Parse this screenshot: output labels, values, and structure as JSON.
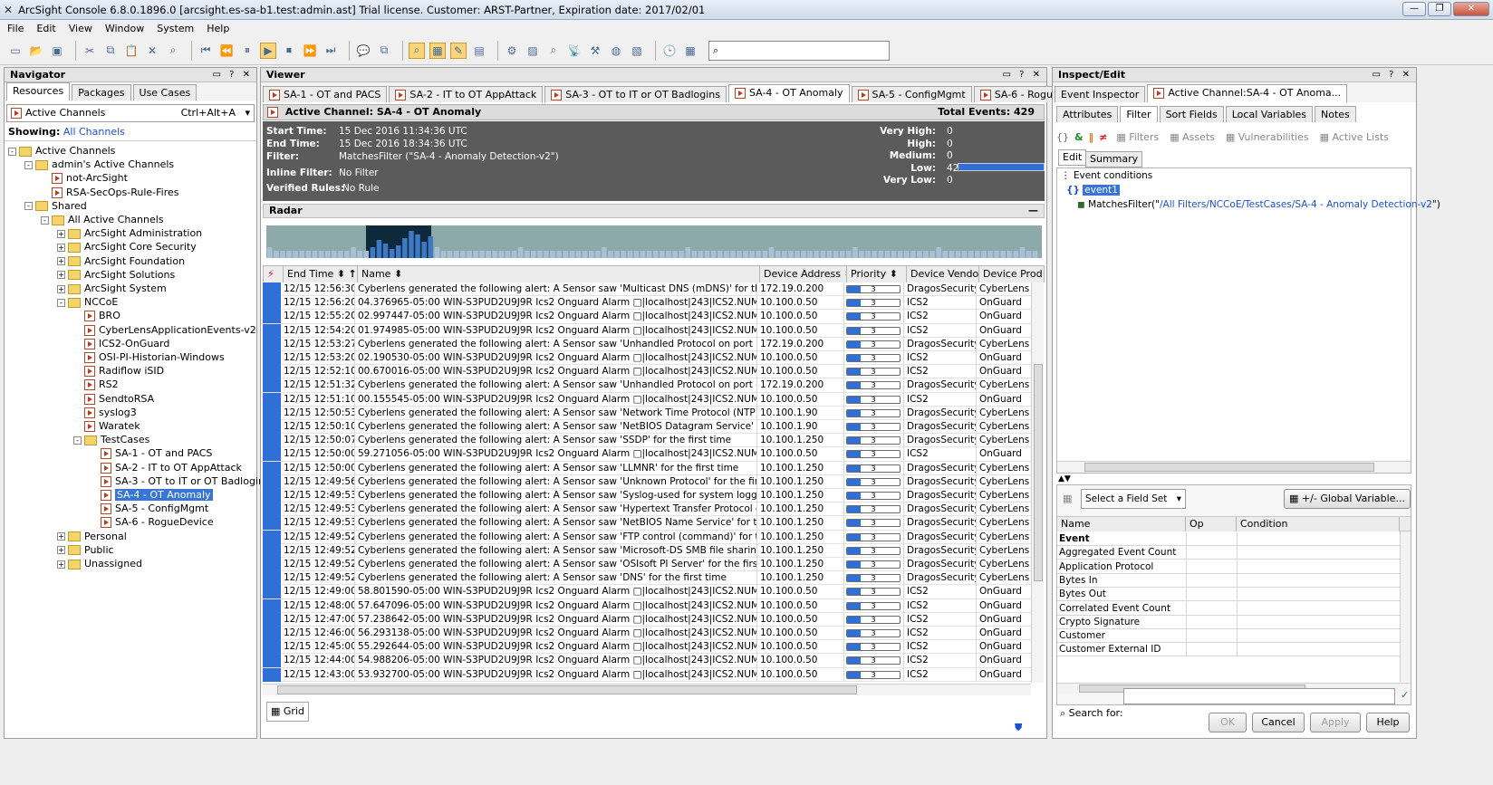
{
  "window": {
    "title": "ArcSight Console 6.8.0.1896.0 [arcsight.es-sa-b1.test:admin.ast] Trial license. Customer: ARST-Partner, Expiration date: 2017/02/01"
  },
  "menu": [
    "File",
    "Edit",
    "View",
    "Window",
    "System",
    "Help"
  ],
  "navigator": {
    "title": "Navigator",
    "tabs": [
      "Resources",
      "Packages",
      "Use Cases"
    ],
    "dropdown": "Active Channels",
    "shortcut": "Ctrl+Alt+A",
    "showing_label": "Showing:",
    "showing_value": "All Channels",
    "tree": [
      {
        "label": "Active Channels",
        "level": 0,
        "type": "folder",
        "pm": "-"
      },
      {
        "label": "admin's Active Channels",
        "level": 1,
        "type": "folder",
        "pm": "-"
      },
      {
        "label": "not-ArcSight",
        "level": 2,
        "type": "item"
      },
      {
        "label": "RSA-SecOps-Rule-Fires",
        "level": 2,
        "type": "item"
      },
      {
        "label": "Shared",
        "level": 1,
        "type": "folder",
        "pm": "-"
      },
      {
        "label": "All Active Channels",
        "level": 2,
        "type": "folder",
        "pm": "-"
      },
      {
        "label": "ArcSight Administration",
        "level": 3,
        "type": "folder",
        "pm": "+"
      },
      {
        "label": "ArcSight Core Security",
        "level": 3,
        "type": "folder",
        "pm": "+"
      },
      {
        "label": "ArcSight Foundation",
        "level": 3,
        "type": "folder",
        "pm": "+"
      },
      {
        "label": "ArcSight Solutions",
        "level": 3,
        "type": "folder",
        "pm": "+"
      },
      {
        "label": "ArcSight System",
        "level": 3,
        "type": "folder",
        "pm": "+"
      },
      {
        "label": "NCCoE",
        "level": 3,
        "type": "folder",
        "pm": "-"
      },
      {
        "label": "BRO",
        "level": 4,
        "type": "item"
      },
      {
        "label": "CyberLensApplicationEvents-v2",
        "level": 4,
        "type": "item"
      },
      {
        "label": "ICS2-OnGuard",
        "level": 4,
        "type": "item"
      },
      {
        "label": "OSI-PI-Historian-Windows",
        "level": 4,
        "type": "item"
      },
      {
        "label": "Radiflow iSID",
        "level": 4,
        "type": "item"
      },
      {
        "label": "RS2",
        "level": 4,
        "type": "item"
      },
      {
        "label": "SendtoRSA",
        "level": 4,
        "type": "item"
      },
      {
        "label": "syslog3",
        "level": 4,
        "type": "item"
      },
      {
        "label": "Waratek",
        "level": 4,
        "type": "item"
      },
      {
        "label": "TestCases",
        "level": 4,
        "type": "folder",
        "pm": "-"
      },
      {
        "label": "SA-1 - OT and PACS",
        "level": 5,
        "type": "item"
      },
      {
        "label": "SA-2 - IT to OT AppAttack",
        "level": 5,
        "type": "item"
      },
      {
        "label": "SA-3 - OT to IT or OT Badlogins",
        "level": 5,
        "type": "item"
      },
      {
        "label": "SA-4 - OT Anomaly",
        "level": 5,
        "type": "item",
        "selected": true
      },
      {
        "label": "SA-5 - ConfigMgmt",
        "level": 5,
        "type": "item"
      },
      {
        "label": "SA-6 - RogueDevice",
        "level": 5,
        "type": "item"
      },
      {
        "label": "Personal",
        "level": 3,
        "type": "folder",
        "pm": "+"
      },
      {
        "label": "Public",
        "level": 3,
        "type": "folder",
        "pm": "+"
      },
      {
        "label": "Unassigned",
        "level": 3,
        "type": "folder",
        "pm": "+"
      }
    ]
  },
  "viewer": {
    "title": "Viewer",
    "tabs": [
      "SA-1 - OT and PACS",
      "SA-2 - IT to OT AppAttack",
      "SA-3 - OT to IT or OT Badlogins",
      "SA-4 - OT Anomaly",
      "SA-5 - ConfigMgmt",
      "SA-6 - RogueDevice"
    ],
    "active_tab": 3,
    "channel_label": "Active Channel:",
    "channel_name": "SA-4 - OT Anomaly",
    "total_label": "Total Events:",
    "total_value": "429",
    "info": {
      "start_k": "Start Time:",
      "start_v": "15 Dec 2016 11:34:36 UTC",
      "end_k": "End Time:",
      "end_v": "15 Dec 2016 18:34:36 UTC",
      "filter_k": "Filter:",
      "filter_v": "MatchesFilter (\"SA-4 - Anomaly Detection-v2\")",
      "inline_k": "Inline Filter:",
      "inline_v": "No Filter",
      "verified_k": "Verified Rules:",
      "verified_v": "No Rule"
    },
    "severity": [
      {
        "k": "Very High:",
        "v": "0"
      },
      {
        "k": "High:",
        "v": "0"
      },
      {
        "k": "Medium:",
        "v": "0"
      },
      {
        "k": "Low:",
        "v": "429"
      },
      {
        "k": "Very Low:",
        "v": "0"
      }
    ],
    "low_fill": 1.0,
    "radar_title": "Radar",
    "columns": [
      "End Time",
      "Name",
      "Device Address",
      "Priority",
      "Device Vendor",
      "Device Prod"
    ],
    "sort_mark": "1",
    "rows": [
      [
        "12/15 12:56:30",
        "Cyberlens generated the following alert: A Sensor saw 'Multicast DNS (mDNS)' for the first time",
        "172.19.0.200",
        "3",
        "DragosSecurity",
        "CyberLens"
      ],
      [
        "12/15 12:56:20",
        "04.376965-05:00 WIN-S3PUD2U9J9R Ics2 Onguard Alarm □|localhost|243|ICS2.NUMBER OF T.",
        "10.100.0.50",
        "3",
        "ICS2",
        "OnGuard"
      ],
      [
        "12/15 12:55:20",
        "02.997447-05:00 WIN-S3PUD2U9J9R Ics2 Onguard Alarm □|localhost|243|ICS2.NUMBER OF T.",
        "10.100.0.50",
        "3",
        "ICS2",
        "OnGuard"
      ],
      [
        "12/15 12:54:20",
        "01.974985-05:00 WIN-S3PUD2U9J9R Ics2 Onguard Alarm □|localhost|243|ICS2.NUMBER OF T.",
        "10.100.0.50",
        "3",
        "ICS2",
        "OnGuard"
      ],
      [
        "12/15 12:53:27",
        "Cyberlens generated the following alert: A Sensor saw 'Unhandled Protocol on port 515' for th...",
        "172.19.0.200",
        "3",
        "DragosSecurity",
        "CyberLens"
      ],
      [
        "12/15 12:53:20",
        "02.190530-05:00 WIN-S3PUD2U9J9R Ics2 Onguard Alarm □|localhost|243|ICS2.NUMBER OF T.",
        "10.100.0.50",
        "3",
        "ICS2",
        "OnGuard"
      ],
      [
        "12/15 12:52:10",
        "00.670016-05:00 WIN-S3PUD2U9J9R Ics2 Onguard Alarm □|localhost|243|ICS2.NUMBER OF T.",
        "10.100.0.50",
        "3",
        "ICS2",
        "OnGuard"
      ],
      [
        "12/15 12:51:32",
        "Cyberlens generated the following alert: A Sensor saw 'Unhandled Protocol on port 443' for th...",
        "172.19.0.200",
        "3",
        "DragosSecurity",
        "CyberLens"
      ],
      [
        "12/15 12:51:10",
        "00.155545-05:00 WIN-S3PUD2U9J9R Ics2 Onguard Alarm □|localhost|243|ICS2.NUMBER OF T.",
        "10.100.0.50",
        "3",
        "ICS2",
        "OnGuard"
      ],
      [
        "12/15 12:50:53",
        "Cyberlens generated the following alert: A Sensor saw 'Network Time Protocol (NTP)-used for ...",
        "10.100.1.90",
        "3",
        "DragosSecurity",
        "CyberLens"
      ],
      [
        "12/15 12:50:10",
        "Cyberlens generated the following alert: A Sensor saw 'NetBIOS Datagram Service' for the fir...",
        "10.100.1.90",
        "3",
        "DragosSecurity",
        "CyberLens"
      ],
      [
        "12/15 12:50:07",
        "Cyberlens generated the following alert: A Sensor saw 'SSDP' for the first time",
        "10.100.1.250",
        "3",
        "DragosSecurity",
        "CyberLens"
      ],
      [
        "12/15 12:50:00",
        "59.271056-05:00 WIN-S3PUD2U9J9R Ics2 Onguard Alarm □|localhost|243|ICS2.NUMBER OF T.",
        "10.100.0.50",
        "3",
        "ICS2",
        "OnGuard"
      ],
      [
        "12/15 12:50:00",
        "Cyberlens generated the following alert: A Sensor saw 'LLMNR' for the first time",
        "10.100.1.250",
        "3",
        "DragosSecurity",
        "CyberLens"
      ],
      [
        "12/15 12:49:56",
        "Cyberlens generated the following alert: A Sensor saw 'Unknown Protocol' for the first time",
        "10.100.1.250",
        "3",
        "DragosSecurity",
        "CyberLens"
      ],
      [
        "12/15 12:49:53",
        "Cyberlens generated the following alert: A Sensor saw 'Syslog-used for system logging' for th...",
        "10.100.1.250",
        "3",
        "DragosSecurity",
        "CyberLens"
      ],
      [
        "12/15 12:49:53",
        "Cyberlens generated the following alert: A Sensor saw 'Hypertext Transfer Protocol over TLS/...",
        "10.100.1.250",
        "3",
        "DragosSecurity",
        "CyberLens"
      ],
      [
        "12/15 12:49:53",
        "Cyberlens generated the following alert: A Sensor saw 'NetBIOS Name Service' for the first time",
        "10.100.1.250",
        "3",
        "DragosSecurity",
        "CyberLens"
      ],
      [
        "12/15 12:49:52",
        "Cyberlens generated the following alert: A Sensor saw 'FTP control (command)' for the first time",
        "10.100.1.250",
        "3",
        "DragosSecurity",
        "CyberLens"
      ],
      [
        "12/15 12:49:52",
        "Cyberlens generated the following alert: A Sensor saw 'Microsoft-DS SMB file sharing' for the f...",
        "10.100.1.250",
        "3",
        "DragosSecurity",
        "CyberLens"
      ],
      [
        "12/15 12:49:52",
        "Cyberlens generated the following alert: A Sensor saw 'OSIsoft PI Server' for the first time",
        "10.100.1.250",
        "3",
        "DragosSecurity",
        "CyberLens"
      ],
      [
        "12/15 12:49:52",
        "Cyberlens generated the following alert: A Sensor saw 'DNS' for the first time",
        "10.100.1.250",
        "3",
        "DragosSecurity",
        "CyberLens"
      ],
      [
        "12/15 12:49:00",
        "58.801590-05:00 WIN-S3PUD2U9J9R Ics2 Onguard Alarm □|localhost|243|ICS2.NUMBER OF T.",
        "10.100.0.50",
        "3",
        "ICS2",
        "OnGuard"
      ],
      [
        "12/15 12:48:00",
        "57.647096-05:00 WIN-S3PUD2U9J9R Ics2 Onguard Alarm □|localhost|243|ICS2.NUMBER OF T.",
        "10.100.0.50",
        "3",
        "ICS2",
        "OnGuard"
      ],
      [
        "12/15 12:47:00",
        "57.238642-05:00 WIN-S3PUD2U9J9R Ics2 Onguard Alarm □|localhost|243|ICS2.NUMBER OF T.",
        "10.100.0.50",
        "3",
        "ICS2",
        "OnGuard"
      ],
      [
        "12/15 12:46:00",
        "56.293138-05:00 WIN-S3PUD2U9J9R Ics2 Onguard Alarm □|localhost|243|ICS2.NUMBER OF T.",
        "10.100.0.50",
        "3",
        "ICS2",
        "OnGuard"
      ],
      [
        "12/15 12:45:00",
        "55.292644-05:00 WIN-S3PUD2U9J9R Ics2 Onguard Alarm □|localhost|243|ICS2.NUMBER OF T.",
        "10.100.0.50",
        "3",
        "ICS2",
        "OnGuard"
      ],
      [
        "12/15 12:44:00",
        "54.988206-05:00 WIN-S3PUD2U9J9R Ics2 Onguard Alarm □|localhost|243|ICS2.NUMBER OF T.",
        "10.100.0.50",
        "3",
        "ICS2",
        "OnGuard"
      ],
      [
        "12/15 12:43:00",
        "53.932700-05:00 WIN-S3PUD2U9J9R Ics2 Onguard Alarm □|localhost|243|ICS2.NUMBER OF T.",
        "10.100.0.50",
        "3",
        "ICS2",
        "OnGuard"
      ]
    ],
    "priority_fill": 0.25,
    "grid_tab": "Grid"
  },
  "inspect": {
    "title": "Inspect/Edit",
    "tabs": [
      "Event Inspector",
      "Active Channel:SA-4 - OT Anoma..."
    ],
    "subtabs": [
      "Attributes",
      "Filter",
      "Sort Fields",
      "Local Variables",
      "Notes"
    ],
    "active_subtab": 1,
    "filter_tools": [
      "Filters",
      "Assets",
      "Vulnerabilities",
      "Active Lists"
    ],
    "edit_tabs": [
      "Edit",
      "Summary"
    ],
    "conditions_root": "Event conditions",
    "event_node": "event1",
    "matches_prefix": "MatchesFilter(\"",
    "matches_path": "/All Filters/NCCoE/TestCases/SA-4 - Anomaly Detection-v2",
    "matches_suffix": "\")",
    "fieldset_placeholder": "Select a Field Set",
    "global_var_btn": "+/- Global Variable...",
    "field_columns": [
      "Name",
      "Op",
      "Condition"
    ],
    "fields": [
      "Event",
      "Aggregated Event Count",
      "Application Protocol",
      "Bytes In",
      "Bytes Out",
      "Correlated Event Count",
      "Crypto Signature",
      "Customer",
      "Customer External ID"
    ],
    "search_label": "Search for:",
    "buttons": [
      "OK",
      "Cancel",
      "Apply",
      "Help"
    ]
  },
  "colors": {
    "accent": "#3875d7",
    "selection": "#3875d7",
    "priority_bar": "#2f6fd6"
  }
}
